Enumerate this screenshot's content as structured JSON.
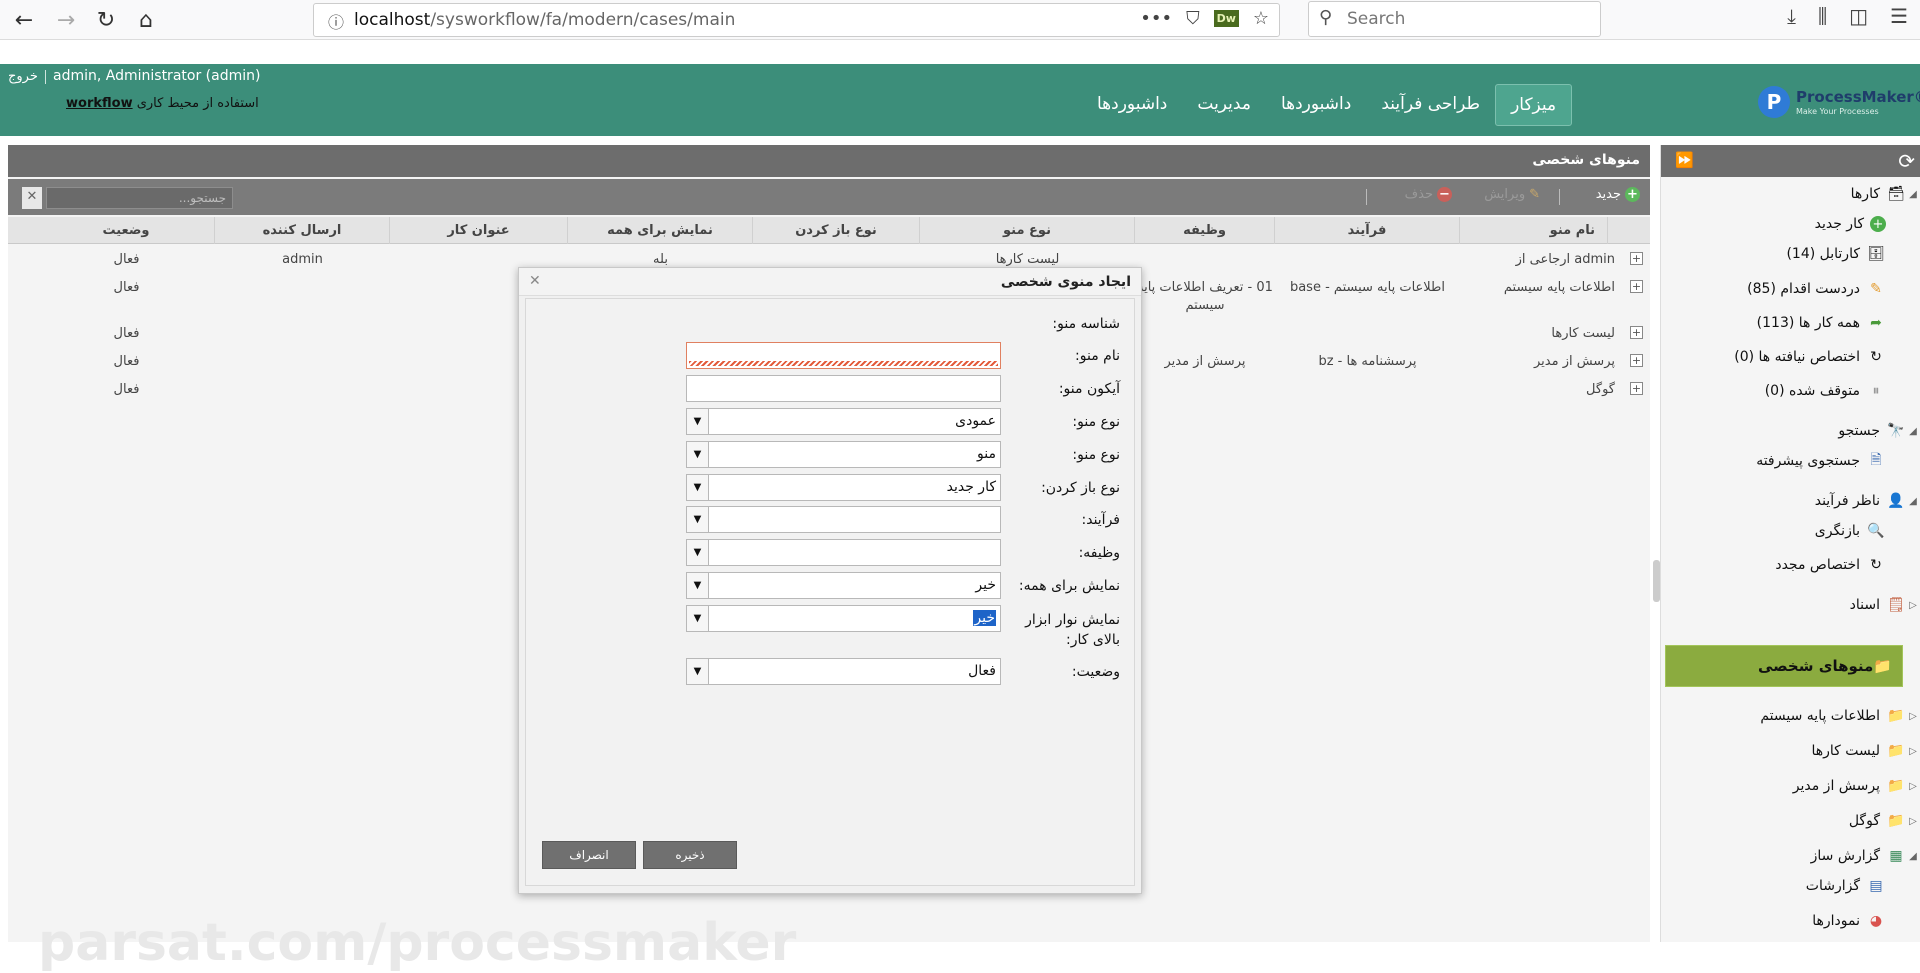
{
  "browser": {
    "url_host": "localhost",
    "url_path": "/sysworkflow/fa/modern/cases/main",
    "search_placeholder": "Search"
  },
  "header": {
    "user": "admin, Administrator (admin)",
    "logout": "خروج",
    "workspace_prefix": "استفاده از محیط کاری",
    "workspace_name": "workflow",
    "nav": [
      "میزکار",
      "طراحی فرآیند",
      "داشبوردها",
      "مدیریت",
      "داشبوردها"
    ],
    "logo_brand": "ProcessMaker®",
    "logo_tag": "Make Your Processes"
  },
  "panel": {
    "title": "منوهای شخصی",
    "toolbar": {
      "new": "جدید",
      "edit": "ویرایش",
      "delete": "حذف",
      "search_placeholder": "جستجو..."
    },
    "columns": [
      "نام منو",
      "فرآیند",
      "وظیفه",
      "نوع منو",
      "نوع باز کردن",
      "نمایش برای همه",
      "عنوان کار",
      "ارسال کننده",
      "وضعیت"
    ],
    "rows": [
      {
        "name": "ارجاعی از admin",
        "process": "",
        "task": "",
        "menu_type": "لیست کارها",
        "open_type": "",
        "show_all": "بله",
        "title": "",
        "sender": "admin",
        "status": "فعال"
      },
      {
        "name": "اطلاعات پایه سیستم",
        "process": "base - اطلاعات پایه سیستم",
        "task": "01 - تعریف اطلاعات پایه سیستم",
        "menu_type": "",
        "open_type": "",
        "show_all": "",
        "title": "",
        "sender": "",
        "status": "فعال"
      },
      {
        "name": "لیست کارها",
        "process": "",
        "task": "",
        "menu_type": "",
        "open_type": "",
        "show_all": "",
        "title": "",
        "sender": "",
        "status": "فعال"
      },
      {
        "name": "پرسش از مدیر",
        "process": "bz - پرسشنامه ها",
        "task": "پرسش از مدیر",
        "menu_type": "",
        "open_type": "",
        "show_all": "",
        "title": "",
        "sender": "",
        "status": "فعال"
      },
      {
        "name": "گوگل",
        "process": "",
        "task": "",
        "menu_type": "",
        "open_type": "",
        "show_all": "",
        "title": "",
        "sender": "",
        "status": "فعال"
      }
    ],
    "watermark": "parsat.com/processmaker"
  },
  "modal": {
    "title": "ایجاد منوی شخصی",
    "fields": {
      "id_label": "شناسه منو:",
      "name_label": "نام منو:",
      "icon_label": "آیکون منو:",
      "type1_label": "نوع منو:",
      "type1_value": "عمودی",
      "type2_label": "نوع منو:",
      "type2_value": "منو",
      "open_label": "نوع باز کردن:",
      "open_value": "کار جدید",
      "process_label": "فرآیند:",
      "task_label": "وظیفه:",
      "showall_label": "نمایش برای همه:",
      "showall_value": "خیر",
      "toolbar_label": "نمایش نوار ابزار بالای کار:",
      "toolbar_value": "خیر",
      "status_label": "وضعیت:",
      "status_value": "فعال"
    },
    "save": "ذخیره",
    "cancel": "انصراف"
  },
  "sidebar": {
    "items": [
      {
        "label": "کارها",
        "icon": "cases-icon",
        "level": 0
      },
      {
        "label": "کار جدید",
        "icon": "new-case-icon",
        "level": 1
      },
      {
        "label": "کارتابل (14)",
        "icon": "inbox-icon",
        "level": 1
      },
      {
        "label": "دردست اقدام (85)",
        "icon": "draft-icon",
        "level": 1
      },
      {
        "label": "همه کار ها (113)",
        "icon": "participated-icon",
        "level": 1
      },
      {
        "label": "اختصاص نیافته ها (0)",
        "icon": "unassigned-icon",
        "level": 1
      },
      {
        "label": "متوقف شده (0)",
        "icon": "paused-icon",
        "level": 1
      },
      {
        "label": "جستجو",
        "icon": "binoculars-icon",
        "level": 0
      },
      {
        "label": "جستجوی پیشرفته",
        "icon": "advanced-search-icon",
        "level": 1
      },
      {
        "label": "ناظر فرآیند",
        "icon": "supervisor-icon",
        "level": 0
      },
      {
        "label": "بازنگری",
        "icon": "review-icon",
        "level": 1
      },
      {
        "label": "اختصاص مجدد",
        "icon": "reassign-icon",
        "level": 1
      },
      {
        "label": "اسناد",
        "icon": "documents-icon",
        "level": 0
      },
      {
        "label": "منوهای شخصی",
        "icon": "folder-icon",
        "level": 0
      },
      {
        "label": "اطلاعات پایه سیستم",
        "icon": "folder-icon",
        "level": 1
      },
      {
        "label": "لیست کارها",
        "icon": "folder-icon",
        "level": 1
      },
      {
        "label": "پرسش از مدیر",
        "icon": "folder-icon",
        "level": 1
      },
      {
        "label": "گوگل",
        "icon": "folder-icon",
        "level": 1
      },
      {
        "label": "گزارش ساز",
        "icon": "report-builder-icon",
        "level": 0
      },
      {
        "label": "گزارشات",
        "icon": "reports-icon",
        "level": 1
      },
      {
        "label": "نمودارها",
        "icon": "chart-icon",
        "level": 1
      }
    ]
  },
  "colors": {
    "header": "#3c8e7a",
    "active_menu": "#8bab3f",
    "panel_bar": "#6d6d6d"
  }
}
